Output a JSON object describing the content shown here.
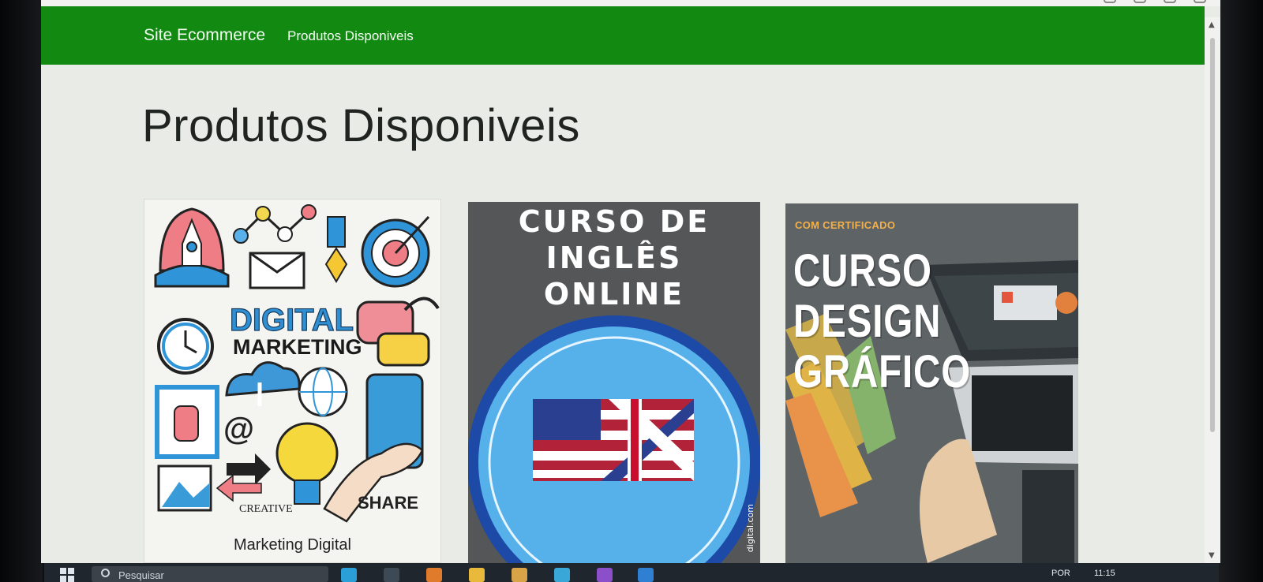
{
  "navbar": {
    "brand": "Site Ecommerce",
    "link": "Produtos Disponiveis"
  },
  "page": {
    "title": "Produtos Disponiveis"
  },
  "products": [
    {
      "caption": "Marketing Digital",
      "image_text": [
        "DIGITAL",
        "MARKETING",
        "CREATIVE",
        "SHARE"
      ]
    },
    {
      "caption": "",
      "image_title_lines": [
        "CURSO DE",
        "INGLÊS",
        "ONLINE"
      ],
      "image_side_text": "digital.com",
      "image_script": "English"
    },
    {
      "caption": "",
      "badge": "COM CERTIFICADO",
      "image_title_lines": [
        "CURSO",
        "DESIGN",
        "GRÁFICO"
      ]
    }
  ],
  "taskbar": {
    "search_placeholder": "Pesquisar",
    "language": "POR",
    "time": "11:15"
  },
  "colors": {
    "navbar": "#128a12",
    "page_bg": "#e9ece6"
  }
}
